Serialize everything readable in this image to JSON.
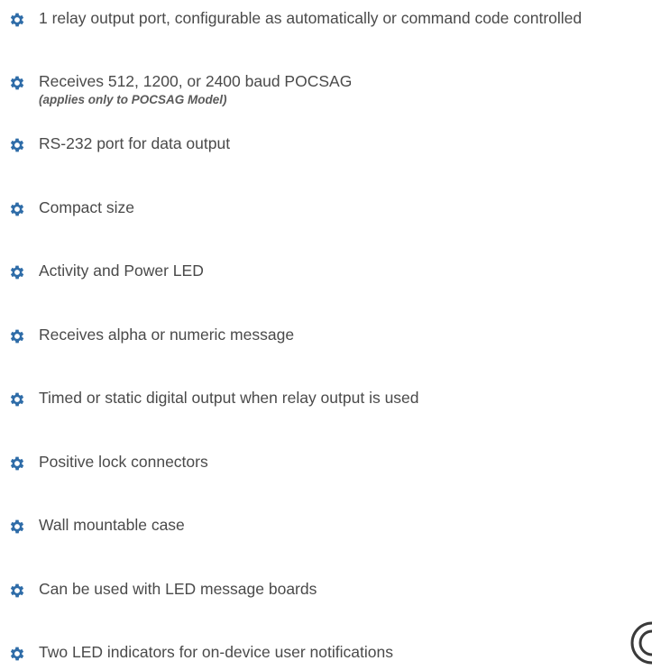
{
  "features": [
    {
      "text": "1 relay output port, configurable as automatically or command code controlled",
      "note": ""
    },
    {
      "text": "Receives 512, 1200, or 2400 baud POCSAG",
      "note": "(applies only to POCSAG Model)"
    },
    {
      "text": "RS-232 port for data output",
      "note": ""
    },
    {
      "text": "Compact size",
      "note": ""
    },
    {
      "text": "Activity and Power LED",
      "note": ""
    },
    {
      "text": "Receives alpha or numeric message",
      "note": ""
    },
    {
      "text": "Timed or static digital output when relay output is used",
      "note": ""
    },
    {
      "text": "Positive lock connectors",
      "note": ""
    },
    {
      "text": "Wall mountable case",
      "note": ""
    },
    {
      "text": "Can be used with LED message boards",
      "note": ""
    },
    {
      "text": "Two LED indicators for on-device user notifications",
      "note": ""
    }
  ],
  "colors": {
    "icon_fill": "#2e6ca8",
    "text": "#4a4a4a"
  },
  "icons": {
    "bullet": "gear-icon",
    "corner": "circle-logo-icon"
  }
}
